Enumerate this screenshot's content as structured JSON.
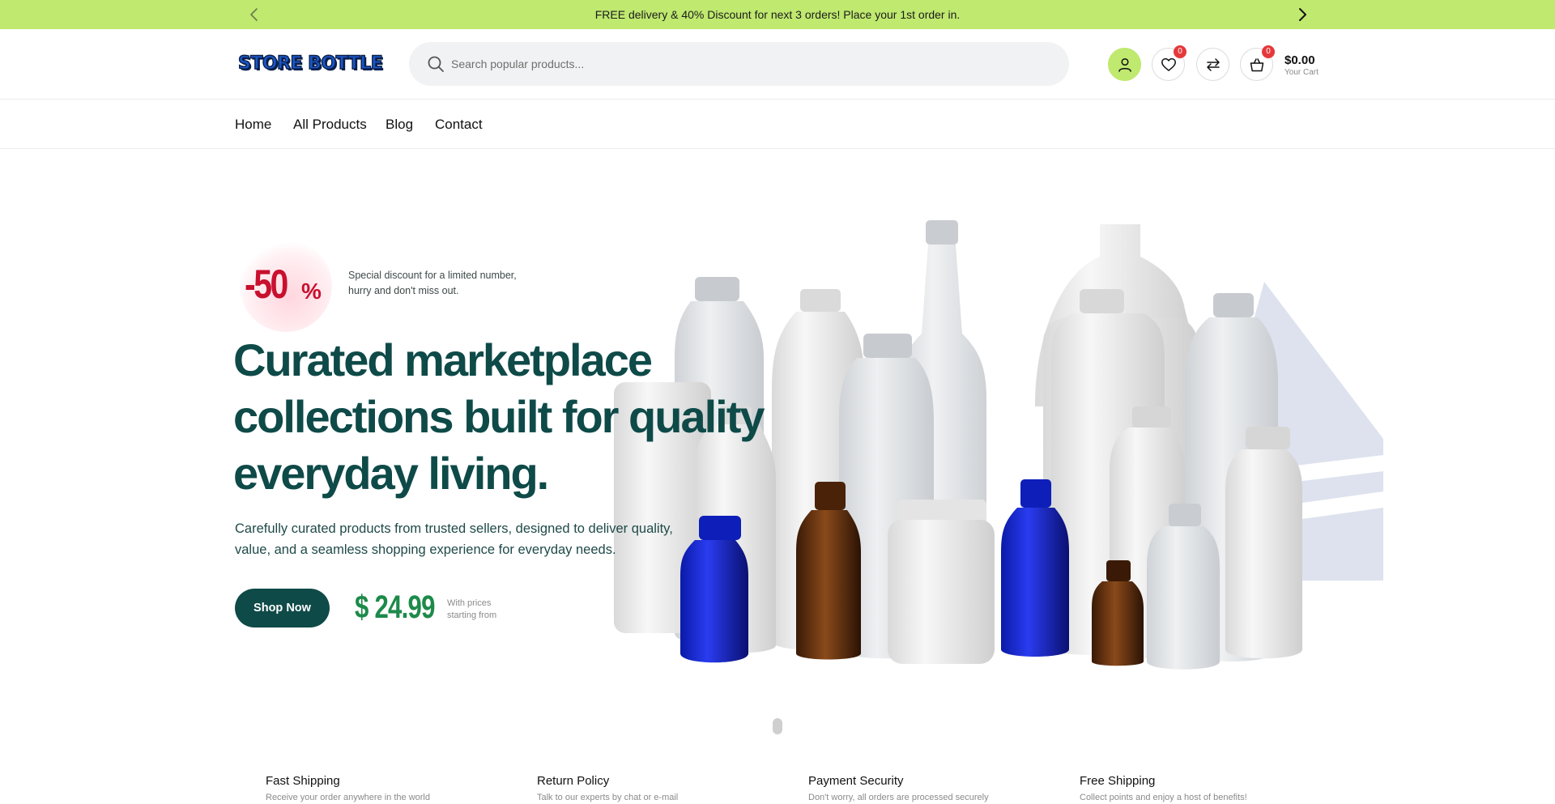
{
  "topbar": {
    "message": "FREE delivery & 40% Discount for next 3 orders! Place your 1st order in."
  },
  "header": {
    "logo_text": "STORE BOTTLE",
    "search_placeholder": "Search popular products...",
    "wishlist_count": "0",
    "cart_count": "0",
    "cart_total": "$0.00",
    "cart_label": "Your Cart"
  },
  "nav": {
    "items": [
      "Home",
      "All Products",
      "Blog",
      "Contact"
    ]
  },
  "hero": {
    "discount": "-50",
    "discount_sign": "%",
    "discount_note": "Special discount for a limited number, hurry and don't miss out.",
    "title": "Curated marketplace collections built for quality everyday living.",
    "description": "Carefully curated products from trusted sellers, designed to deliver quality, value, and a seamless shopping experience for everyday needs.",
    "cta_label": "Shop Now",
    "price": "$ 24.99",
    "price_note": "With prices starting from"
  },
  "features": [
    {
      "title": "Fast Shipping",
      "subtitle": "Receive your order anywhere in the world"
    },
    {
      "title": "Return Policy",
      "subtitle": "Talk to our experts by chat or e-mail"
    },
    {
      "title": "Payment Security",
      "subtitle": "Don't worry, all orders are processed securely"
    },
    {
      "title": "Free Shipping",
      "subtitle": "Collect points and enjoy a host of benefits!"
    }
  ],
  "colors": {
    "topbar_bg": "#bfe96f",
    "brand_dark": "#0e4a48",
    "discount_red": "#c8102e",
    "price_green": "#1d8a4a",
    "badge_red": "#e5383b"
  },
  "icons": [
    "chevron-left-icon",
    "chevron-right-icon",
    "search-icon",
    "user-icon",
    "heart-icon",
    "compare-arrows-icon",
    "shopping-bag-icon"
  ]
}
